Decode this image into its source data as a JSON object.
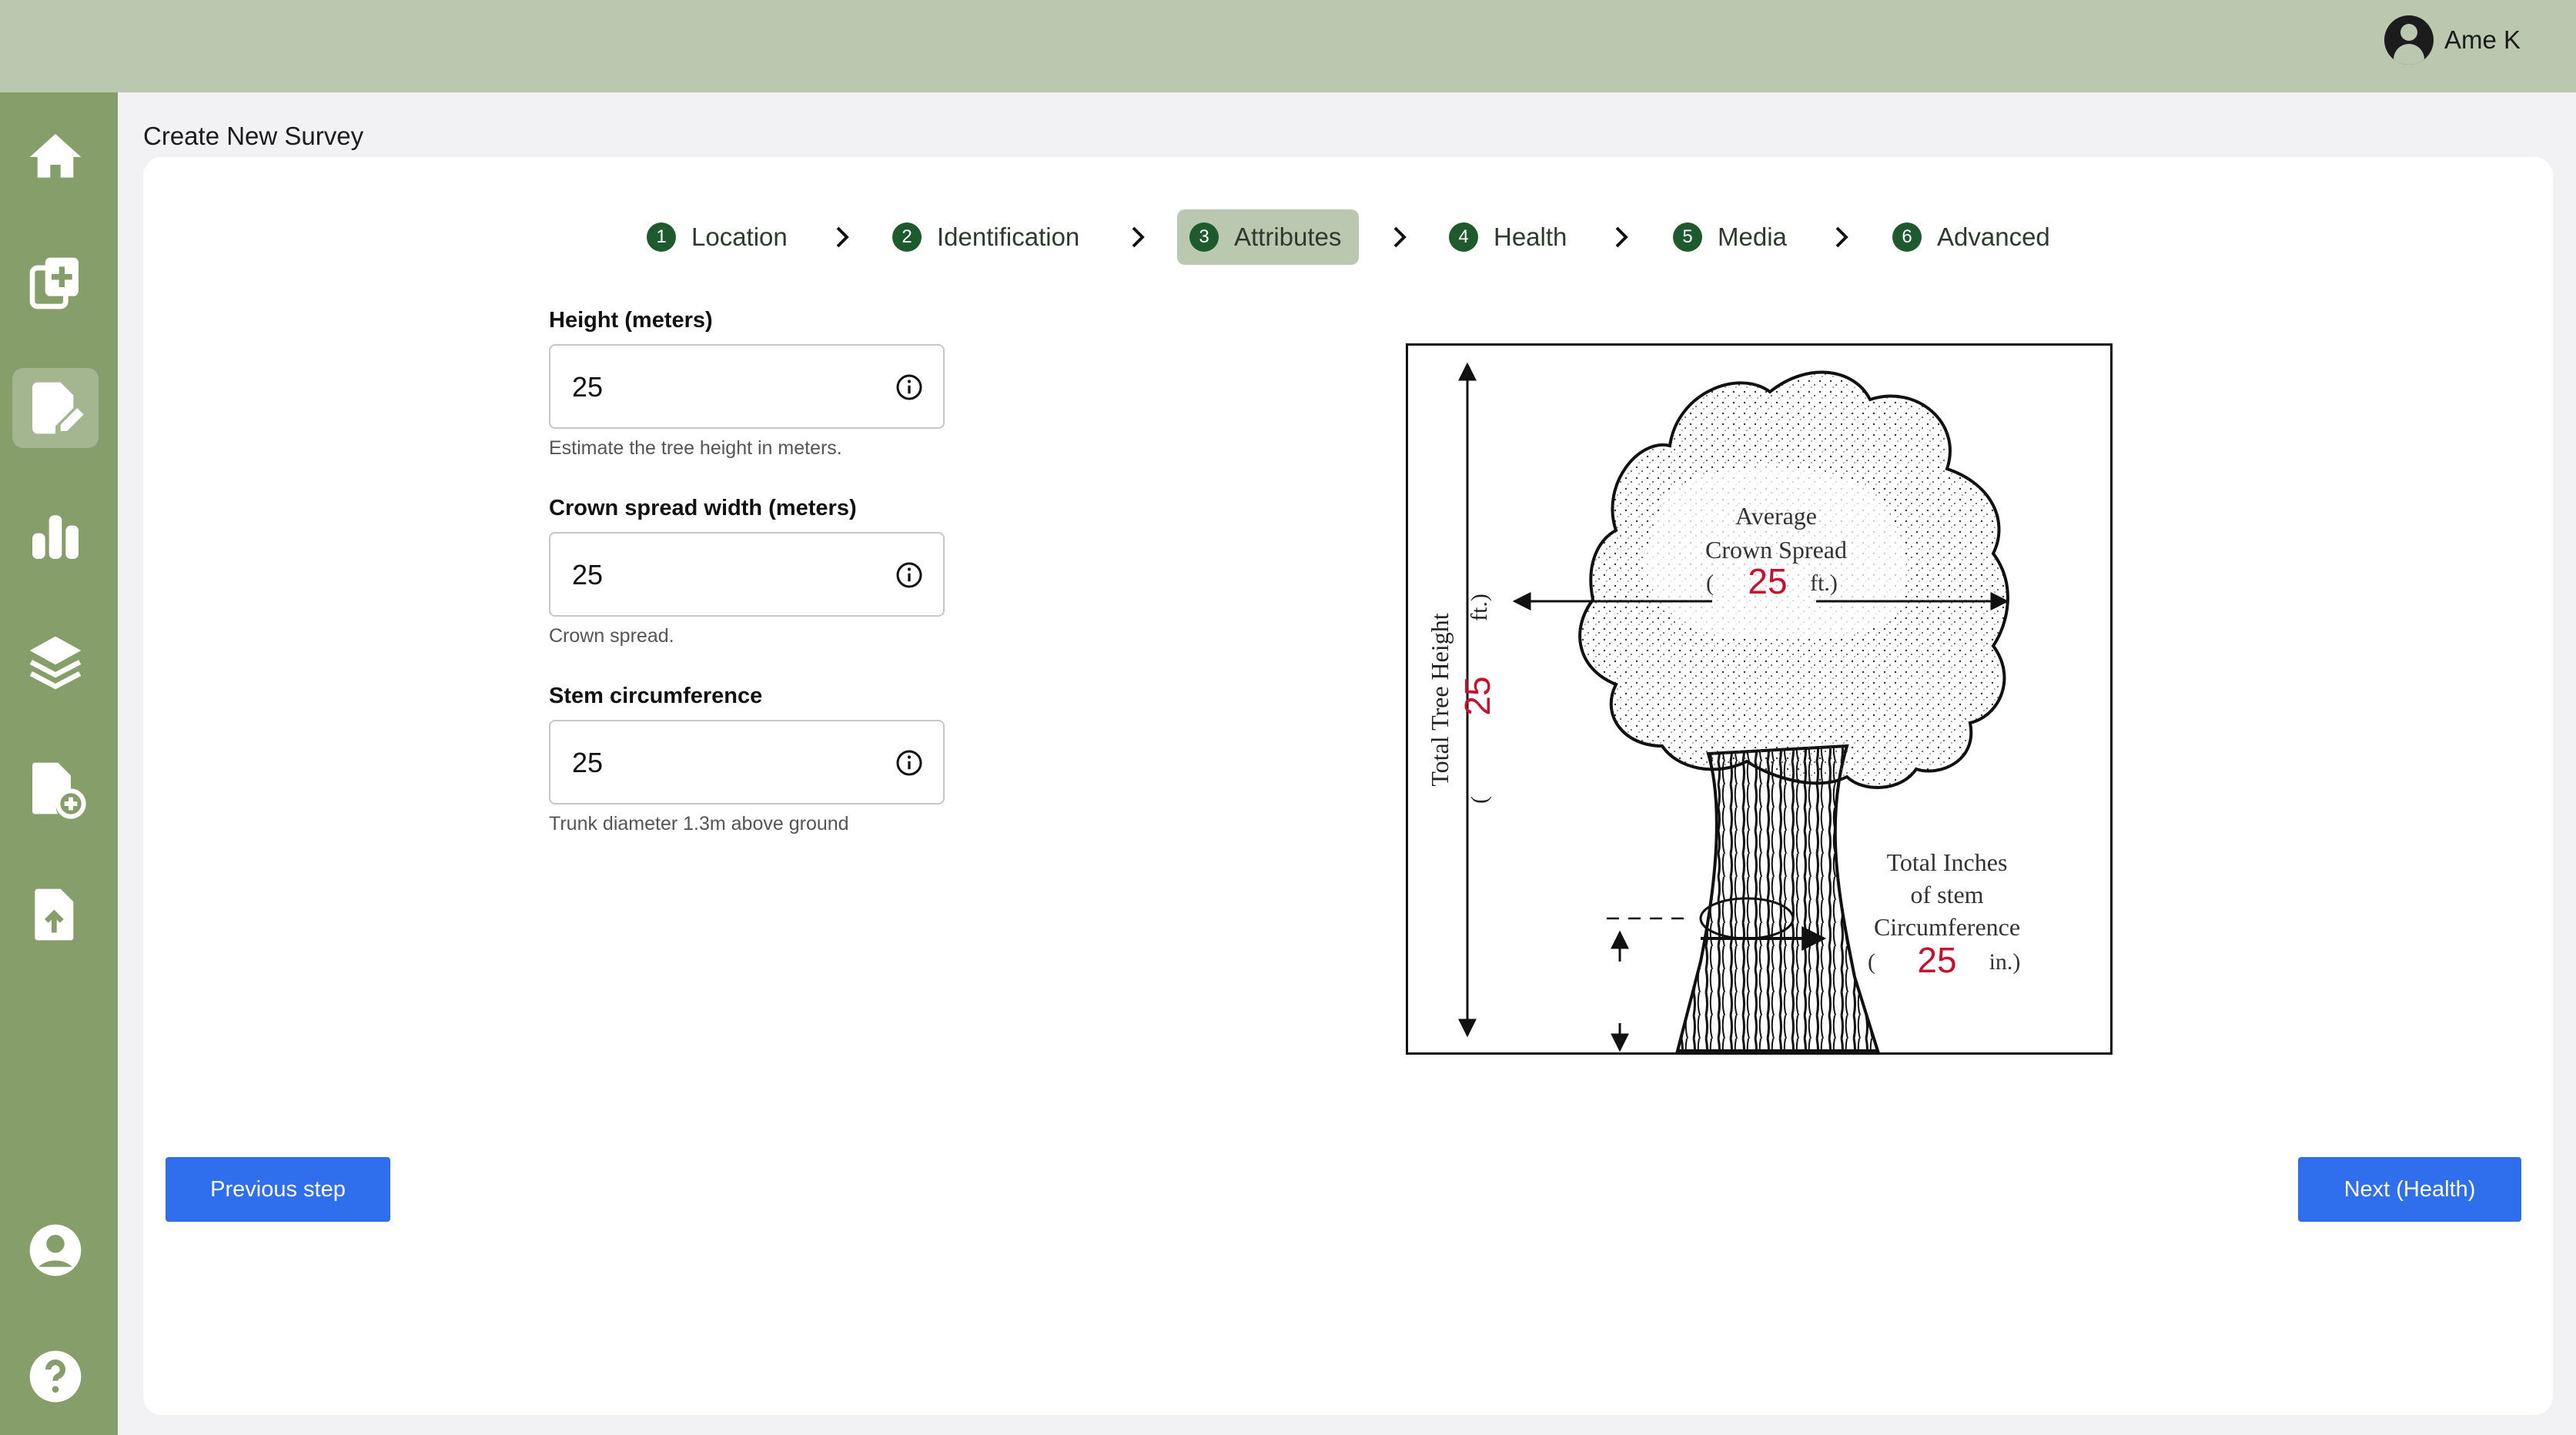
{
  "header": {
    "user_name": "Ame K"
  },
  "sidebar": {
    "items": [
      {
        "name": "home",
        "icon": "home-icon"
      },
      {
        "name": "new-survey",
        "icon": "add-copy-icon"
      },
      {
        "name": "edit-survey",
        "icon": "edit-document-icon",
        "active": true
      },
      {
        "name": "charts",
        "icon": "bar-chart-icon"
      },
      {
        "name": "layers",
        "icon": "layers-icon"
      },
      {
        "name": "add-file",
        "icon": "add-file-icon"
      },
      {
        "name": "upload",
        "icon": "upload-file-icon"
      },
      {
        "name": "profile",
        "icon": "account-circle-icon"
      },
      {
        "name": "help",
        "icon": "help-icon"
      }
    ],
    "active_color": "#a4b68f"
  },
  "page": {
    "title": "Create New Survey"
  },
  "stepper": {
    "steps": [
      {
        "num": "1",
        "label": "Location"
      },
      {
        "num": "2",
        "label": "Identification"
      },
      {
        "num": "3",
        "label": "Attributes",
        "active": true
      },
      {
        "num": "4",
        "label": "Health"
      },
      {
        "num": "5",
        "label": "Media"
      },
      {
        "num": "6",
        "label": "Advanced"
      }
    ]
  },
  "form": {
    "height": {
      "label": "Height (meters)",
      "value": "25",
      "help": "Estimate the tree height in meters."
    },
    "crown": {
      "label": "Crown spread width (meters)",
      "value": "25",
      "help": "Crown spread."
    },
    "stem": {
      "label": "Stem circumference",
      "value": "25",
      "help": "Trunk diameter 1.3m above ground"
    }
  },
  "diagram": {
    "height_label": "Total Tree Height",
    "height_unit_open": "(",
    "height_unit_close": "ft.)",
    "height_value": "25",
    "crown_label_1": "Average",
    "crown_label_2": "Crown Spread",
    "crown_open": "(",
    "crown_unit": "ft.)",
    "crown_value": "25",
    "stem_label_1": "Total Inches",
    "stem_label_2": "of stem",
    "stem_label_3": "Circumference",
    "stem_open": "(",
    "stem_unit": "in.)",
    "stem_value": "25",
    "value_color": "#c8102e"
  },
  "actions": {
    "previous_label": "Previous step",
    "next_label": "Next (Health)"
  },
  "colors": {
    "accent": "#2f6fee",
    "step_badge": "#1e5a2e",
    "topbar": "#bac8b0",
    "sidebar": "#869e69"
  }
}
